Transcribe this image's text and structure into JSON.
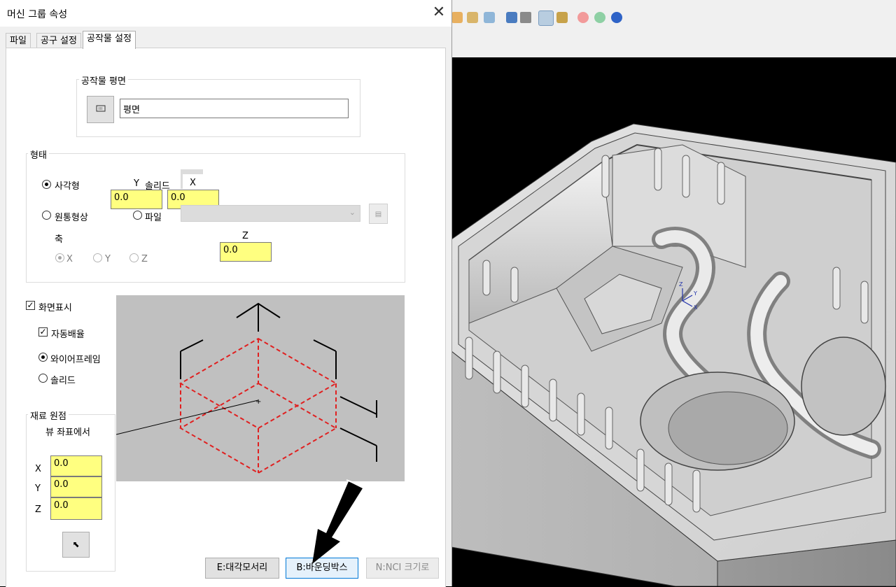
{
  "dialog": {
    "title": "머신 그룹 속성",
    "tabs": [
      {
        "label": "파일"
      },
      {
        "label": "공구 설정"
      },
      {
        "label": "공작물 설정"
      }
    ]
  },
  "stock_plane": {
    "group_label": "공작물 평면",
    "plane_value": "평면"
  },
  "shape": {
    "group_label": "형태",
    "rectangular_label": "사각형",
    "solid_label": "솔리드",
    "cylindrical_label": "원통형상",
    "file_label": "파일",
    "y_label": "Y",
    "x_label": "X",
    "z_label": "Z",
    "y_value": "0.0",
    "x_value": "0.0",
    "z_value": "0.0",
    "axis_label": "축",
    "axis_x": "X",
    "axis_y": "Y",
    "axis_z": "Z"
  },
  "display": {
    "display_label": "화면표시",
    "auto_fit_label": "자동배율",
    "wireframe_label": "와이어프레임",
    "solid_label": "솔리드"
  },
  "origin": {
    "group_label": "재료 원점",
    "subtitle": "뷰 좌표에서",
    "x_label": "X",
    "y_label": "Y",
    "z_label": "Z",
    "x_value": "0.0",
    "y_value": "0.0",
    "z_value": "0.0"
  },
  "buttons": {
    "all_entities": "E:대각모서리",
    "bounding_box": "B:바운딩박스",
    "nci_extents": "N:NCI 크기로"
  },
  "colors": {
    "input_bg": "#ffff80",
    "wireframe": "#e02020",
    "viewport_bg": "#000000"
  }
}
